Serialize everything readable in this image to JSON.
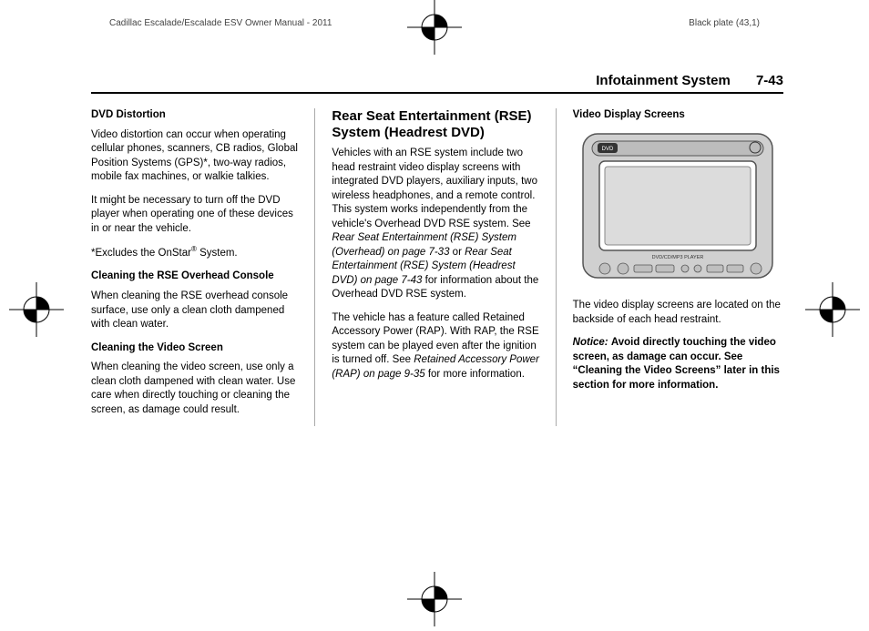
{
  "header": {
    "manual_title": "Cadillac Escalade/Escalade ESV Owner Manual - 2011",
    "plate_info": "Black plate (43,1)"
  },
  "section": {
    "title": "Infotainment System",
    "page": "7-43"
  },
  "col1": {
    "h1": "DVD Distortion",
    "p1": "Video distortion can occur when operating cellular phones, scanners, CB radios, Global Position Systems (GPS)*, two-way radios, mobile fax machines, or walkie talkies.",
    "p2": "It might be necessary to turn off the DVD player when operating one of these devices in or near the vehicle.",
    "p3_pre": "*Excludes the OnStar",
    "p3_post": " System.",
    "h2": "Cleaning the RSE Overhead Console",
    "p4": "When cleaning the RSE overhead console surface, use only a clean cloth dampened with clean water.",
    "h3": "Cleaning the Video Screen",
    "p5": "When cleaning the video screen, use only a clean cloth dampened with clean water. Use care when directly touching or cleaning the screen, as damage could result."
  },
  "col2": {
    "title": "Rear Seat Entertainment (RSE) System (Headrest DVD)",
    "p1_a": "Vehicles with an RSE system include two head restraint video display screens with integrated DVD players, auxiliary inputs, two wireless headphones, and a remote control. This system works independently from the vehicle's Overhead DVD RSE system. See ",
    "p1_link1": "Rear Seat Entertainment (RSE) System (Overhead) on page 7-33",
    "p1_b": " or ",
    "p1_link2": "Rear Seat Entertainment (RSE) System (Headrest DVD) on page 7-43",
    "p1_c": " for information about the Overhead DVD RSE system.",
    "p2_a": "The vehicle has a feature called Retained Accessory Power (RAP). With RAP, the RSE system can be played even after the ignition is turned off. See ",
    "p2_link": "Retained Accessory Power (RAP) on page 9-35",
    "p2_b": " for more information."
  },
  "col3": {
    "h1": "Video Display Screens",
    "figure_label": "DVD/CD/MP3 PLAYER",
    "p1": "The video display screens are located on the backside of each head restraint.",
    "notice_label": "Notice:",
    "notice_text": "Avoid directly touching the video screen, as damage can occur. See “Cleaning the Video Screens” later in this section for more information."
  }
}
